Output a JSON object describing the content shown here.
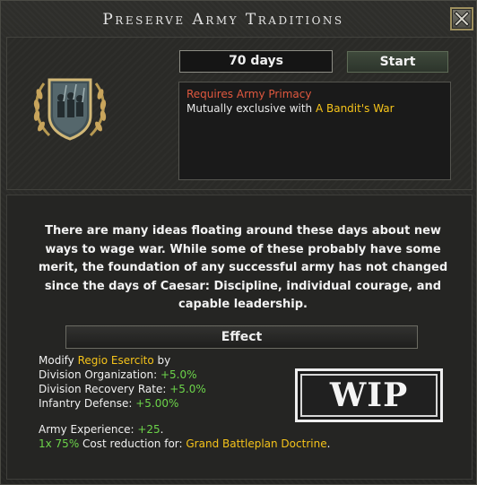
{
  "window": {
    "title": "Preserve Army Traditions"
  },
  "decision": {
    "duration": "70 days",
    "start_label": "Start",
    "requirements": {
      "requires": "Requires Army Primacy",
      "exclusive_prefix": "Mutually exclusive with ",
      "exclusive_target": "A Bandit's War"
    }
  },
  "description": "There are many ideas floating around these days about new ways to wage war. While some of these probably have some merit, the foundation of any successful army has not changed since the days of Caesar: Discipline, individual courage, and capable leadership.",
  "effect": {
    "header": "Effect",
    "modify_prefix": "Modify ",
    "modify_target": "Regio Esercito",
    "modify_suffix": " by",
    "modifiers": [
      {
        "label": "Division Organization: ",
        "value": "+5.0%"
      },
      {
        "label": "Division Recovery Rate: ",
        "value": "+5.0%"
      },
      {
        "label": "Infantry Defense: ",
        "value": "+5.00%"
      }
    ],
    "army_xp_label": "Army Experience: ",
    "army_xp_value": "+25",
    "army_xp_suffix": ".",
    "cost_multiplier": "1x 75%",
    "cost_text": " Cost reduction for: ",
    "cost_target": "Grand Battleplan Doctrine",
    "cost_suffix": "."
  },
  "wip_badge": "WIP",
  "colors": {
    "positive": "#6cd44a",
    "highlight": "#f5c31a",
    "requirement": "#e0583f"
  }
}
